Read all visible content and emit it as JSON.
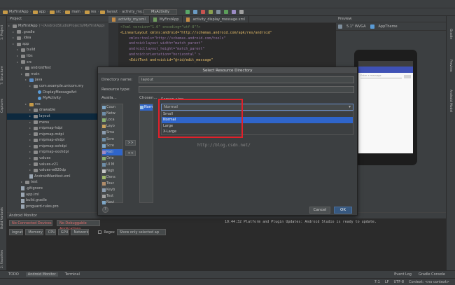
{
  "titlebar": {
    "project": "MyFirstApp",
    "path": "~/AndroidStudioProjects/MyFirstApp"
  },
  "navbar": {
    "crumbs": [
      "MyFirstApp",
      "app",
      "src",
      "main",
      "res",
      "layout",
      "activity_my.xml"
    ],
    "run_config": "MyActivity"
  },
  "project_panel": {
    "header": "Project",
    "items": [
      {
        "label": "MyFirstApp",
        "suffix": "(~/AndroidStudioProjects/MyFirstApp)",
        "indent": 0,
        "type": "folder"
      },
      {
        "label": ".gradle",
        "indent": 1,
        "type": "folder"
      },
      {
        "label": ".idea",
        "indent": 1,
        "type": "folder"
      },
      {
        "label": "app",
        "indent": 1,
        "type": "folder"
      },
      {
        "label": "build",
        "indent": 2,
        "type": "folder"
      },
      {
        "label": "libs",
        "indent": 2,
        "type": "folder"
      },
      {
        "label": "src",
        "indent": 2,
        "type": "folder"
      },
      {
        "label": "androidTest",
        "indent": 3,
        "type": "folder"
      },
      {
        "label": "main",
        "indent": 3,
        "type": "folder"
      },
      {
        "label": "java",
        "indent": 4,
        "type": "bfolder"
      },
      {
        "label": "com.example.unicom.my",
        "indent": 5,
        "type": "folder"
      },
      {
        "label": "DisplayMessageAct",
        "indent": 6,
        "type": "class"
      },
      {
        "label": "MyActivity",
        "indent": 6,
        "type": "class"
      },
      {
        "label": "res",
        "indent": 4,
        "type": "yfolder"
      },
      {
        "label": "drawable",
        "indent": 5,
        "type": "folder"
      },
      {
        "label": "layout",
        "indent": 5,
        "type": "folder"
      },
      {
        "label": "menu",
        "indent": 5,
        "type": "folder"
      },
      {
        "label": "mipmap-hdpi",
        "indent": 5,
        "type": "folder"
      },
      {
        "label": "mipmap-mdpi",
        "indent": 5,
        "type": "folder"
      },
      {
        "label": "mipmap-xhdpi",
        "indent": 5,
        "type": "folder"
      },
      {
        "label": "mipmap-xxhdpi",
        "indent": 5,
        "type": "folder"
      },
      {
        "label": "mipmap-xxxhdpi",
        "indent": 5,
        "type": "folder"
      },
      {
        "label": "values",
        "indent": 5,
        "type": "folder"
      },
      {
        "label": "values-v21",
        "indent": 5,
        "type": "folder"
      },
      {
        "label": "values-w820dp",
        "indent": 5,
        "type": "folder"
      },
      {
        "label": "AndroidManifest.xml",
        "indent": 4,
        "type": "file"
      },
      {
        "label": "test",
        "indent": 3,
        "type": "folder"
      },
      {
        "label": ".gitignore",
        "indent": 2,
        "type": "file"
      },
      {
        "label": "app.iml",
        "indent": 2,
        "type": "file"
      },
      {
        "label": "build.gradle",
        "indent": 2,
        "type": "file"
      },
      {
        "label": "proguard-rules.pro",
        "indent": 2,
        "type": "file"
      }
    ]
  },
  "editor": {
    "tabs": [
      {
        "label": "activity_my.xml",
        "active": true
      },
      {
        "label": "MyFirstApp",
        "active": false
      },
      {
        "label": "activity_display_message.xml",
        "active": false
      }
    ],
    "lines": [
      "<?xml version=\"1.0\" encoding=\"utf-8\"?>",
      "<LinearLayout xmlns:android=\"http://schemas.android.com/apk/res/android\"",
      "    xmlns:tools=\"http://schemas.android.com/tools\"",
      "    android:layout_width=\"match_parent\"",
      "    android:layout_height=\"match_parent\"",
      "    android:orientation=\"horizontal\" >",
      "",
      "    <EditText android:id=\"@+id/edit_message\""
    ]
  },
  "preview": {
    "header": "Preview",
    "device": "5.1\" WVGA",
    "theme": "AppTheme",
    "hint": "Enter a message",
    "button": ""
  },
  "dialog": {
    "title": "Select Resource Directory",
    "directory_name_label": "Directory name:",
    "directory_name_value": "layout",
    "resource_type_label": "Resource type:",
    "available_label": "Availa...",
    "chosen_label": "Chosen...",
    "screen_size_label": "Screen size:",
    "available_items": [
      "Coun",
      "Netw",
      "Loca",
      "Layo",
      "Sma",
      "Scre",
      "Scre",
      "Rati",
      "Orie",
      "UI M",
      "Nigh",
      "Dens",
      "Touc",
      "Keyb",
      "Text",
      "Navi"
    ],
    "chosen_item": "Normal",
    "add_button": ">>",
    "remove_button": "<<",
    "dropdown_value": "Normal",
    "dropdown_options": [
      "Small",
      "Normal",
      "Large",
      "X-Large"
    ],
    "selected_option": "Normal",
    "help": "?",
    "cancel": "Cancel",
    "ok": "OK"
  },
  "watermark": "http://blog.csdn.net/",
  "monitor": {
    "header": "Android Monitor",
    "device": "No Connected Devices",
    "app": "No Debuggable Applications",
    "tabs": [
      "logcat",
      "Memory",
      "CPU",
      "GPU",
      "Network"
    ],
    "regex_label": "Regex",
    "filter": "Show only selected ap",
    "log_time": "10:44:32",
    "log_text": "Platform and Plugin Updates: Android Studio is ready to update."
  },
  "toolwindows": {
    "todo": "TODO",
    "android_monitor": "Android Monitor",
    "terminal": "Terminal",
    "event_log": "Event Log",
    "gradle_console": "Gradle Console"
  },
  "statusbar": {
    "position": "7:1",
    "line_sep": "LF",
    "encoding": "UTF-8",
    "context": "Context: <no context>"
  },
  "left_strip": {
    "project": "1: Project",
    "structure": "7: Structure",
    "captures": "Captures",
    "build_variants": "Build Variants",
    "favorites": "2: Favorites"
  },
  "right_strip": {
    "gradle": "Gradle",
    "preview": "Preview",
    "android_model": "Android Model"
  }
}
